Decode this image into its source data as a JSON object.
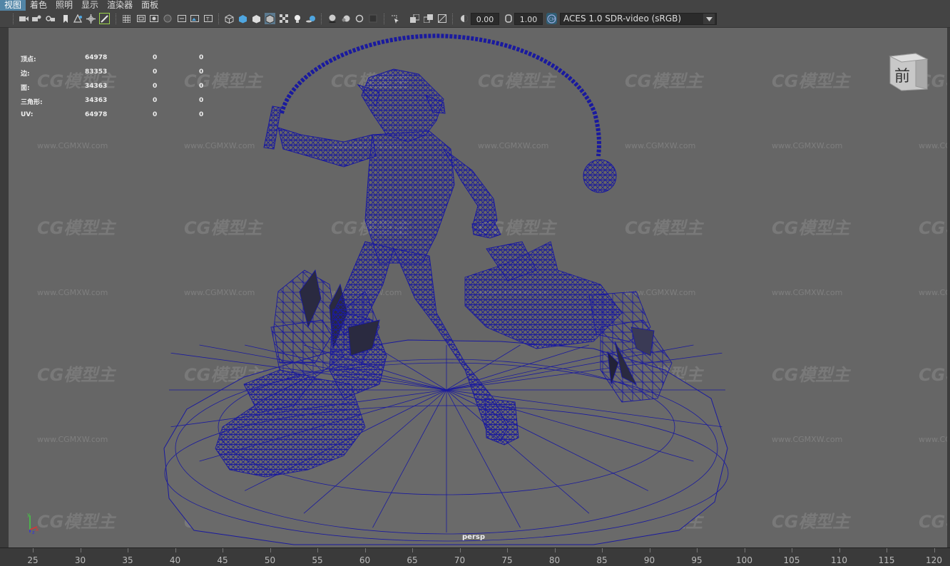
{
  "menu": [
    "视图",
    "着色",
    "照明",
    "显示",
    "渲染器",
    "面板"
  ],
  "toolbar": {
    "exposure_value": "0.00",
    "gamma_value": "1.00",
    "color_space": "ACES 1.0 SDR-video (sRGB)"
  },
  "hud": {
    "rows": [
      {
        "label": "顶点:",
        "total": "64978",
        "selected1": "0",
        "selected2": "0"
      },
      {
        "label": "边:",
        "total": "83353",
        "selected1": "0",
        "selected2": "0"
      },
      {
        "label": "面:",
        "total": "34363",
        "selected1": "0",
        "selected2": "0"
      },
      {
        "label": "三角形:",
        "total": "34363",
        "selected1": "0",
        "selected2": "0"
      },
      {
        "label": "UV:",
        "total": "64978",
        "selected1": "0",
        "selected2": "0"
      }
    ]
  },
  "viewcube": {
    "face_label": "前"
  },
  "camera_label": "persp",
  "watermark": {
    "logo": "CG模型主",
    "url": "www.CGMXW.com"
  },
  "timeline": {
    "ticks": [
      "25",
      "30",
      "35",
      "40",
      "45",
      "50",
      "55",
      "60",
      "65",
      "70",
      "75",
      "80",
      "85",
      "90",
      "95",
      "100",
      "105",
      "110",
      "115",
      "120"
    ]
  },
  "colors": {
    "wireframe": "#1a1a9e",
    "viewport_bg": "#666666",
    "menu_active": "#5285a6"
  }
}
